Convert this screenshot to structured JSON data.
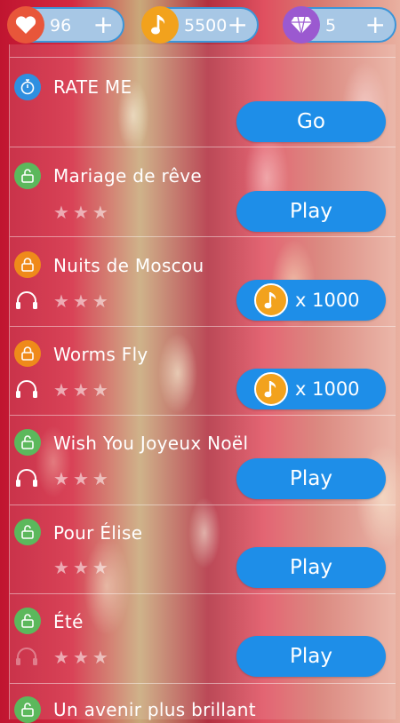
{
  "header": {
    "lives": {
      "value": "96",
      "plus": "+"
    },
    "notes": {
      "value": "5500",
      "plus": "+"
    },
    "gems": {
      "value": "5",
      "plus": "+"
    }
  },
  "songs": [
    {
      "title": "RATE ME",
      "action": "Go",
      "icon": "rate-icon"
    },
    {
      "title": "Mariage de rêve",
      "action": "Play",
      "icon": "unlocked-icon",
      "stars": [
        "★",
        "★",
        "★"
      ]
    },
    {
      "title": "Nuits de Moscou",
      "cost": "x 1000",
      "icon": "locked-icon",
      "stars": [
        "★",
        "★",
        "★"
      ]
    },
    {
      "title": "Worms Fly",
      "cost": "x 1000",
      "icon": "locked-icon",
      "stars": [
        "★",
        "★",
        "★"
      ]
    },
    {
      "title": "Wish You Joyeux Noël",
      "action": "Play",
      "icon": "unlocked-icon",
      "stars": [
        "★",
        "★",
        "★"
      ]
    },
    {
      "title": "Pour Élise",
      "action": "Play",
      "icon": "unlocked-icon",
      "stars": [
        "★",
        "★",
        "★"
      ]
    },
    {
      "title": "Été",
      "action": "Play",
      "icon": "unlocked-icon",
      "stars": [
        "★",
        "★",
        "★"
      ]
    },
    {
      "title": "Un avenir plus brillant",
      "icon": "unlocked-icon"
    }
  ],
  "colors": {
    "button": "#1e8ee8",
    "unlocked": "#5cb85c",
    "locked": "#ef8a1a",
    "rate": "#2f8fe0",
    "heart": "#e8563a",
    "coin": "#f2a21d",
    "gem": "#9b59d0"
  }
}
